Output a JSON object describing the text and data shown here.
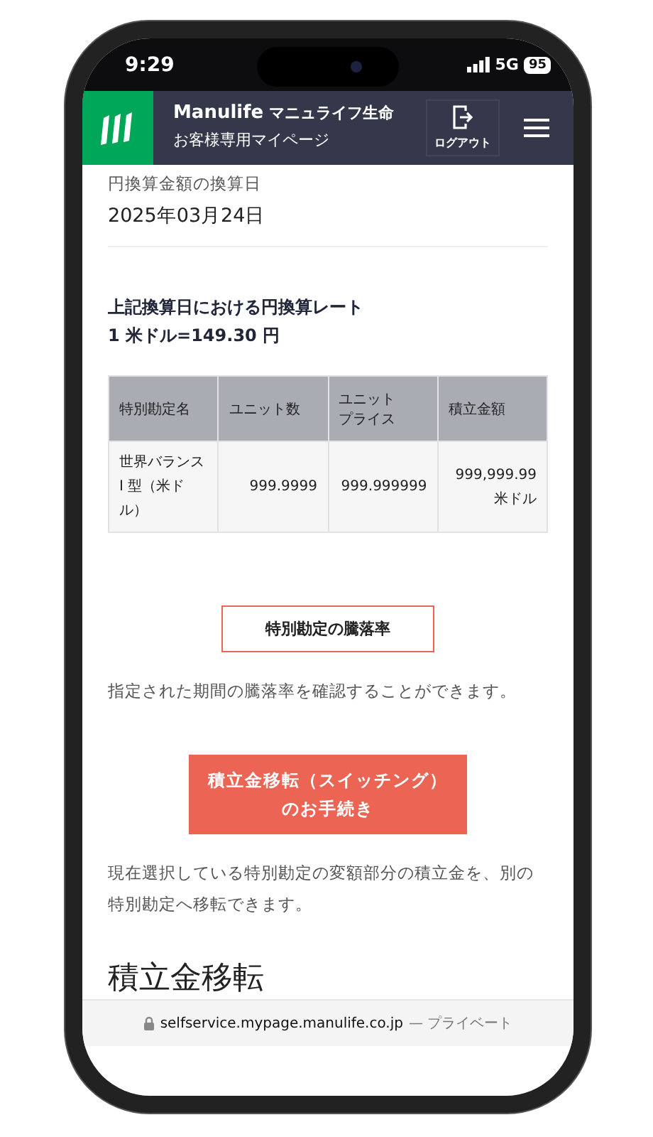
{
  "status_bar": {
    "time": "9:29",
    "network": "5G",
    "battery": "95"
  },
  "header": {
    "brand": "Manulife",
    "brand_ja": "マニュライフ生命",
    "subtitle": "お客様専用マイページ",
    "logout": "ログアウト"
  },
  "conversion": {
    "label": "円換算金額の換算日",
    "date": "2025年03月24日"
  },
  "rate": {
    "title": "上記換算日における円換算レート",
    "value": "1 米ドル=149.30 円"
  },
  "table": {
    "columns": [
      {
        "lines": [
          "特別勘定名"
        ]
      },
      {
        "lines": [
          "ユニット数"
        ]
      },
      {
        "lines": [
          "ユニット",
          "プライス"
        ]
      },
      {
        "lines": [
          "積立金額"
        ]
      }
    ],
    "rows": [
      [
        "世界バランス I 型（米ドル）",
        "999.9999",
        "999.999999",
        "999,999.99\n米ドル"
      ]
    ]
  },
  "performance": {
    "button": "特別勘定の騰落率",
    "description": "指定された期間の騰落率を確認することができます。"
  },
  "switching": {
    "button": [
      "積立金移転（スイッチング）",
      "のお手続き"
    ],
    "description": "現在選択している特別勘定の変額部分の積立金を、別の特別勘定へ移転できます。"
  },
  "section_heading": "積立金移転",
  "url_bar": {
    "url": "selfservice.mypage.manulife.co.jp",
    "mode": "— プライベート"
  }
}
